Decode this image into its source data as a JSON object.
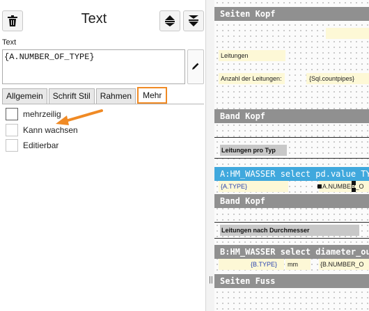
{
  "panel": {
    "title": "Text",
    "text_label": "Text",
    "text_value": "{A.NUMBER_OF_TYPE}",
    "tabs": [
      {
        "label": "Allgemein"
      },
      {
        "label": "Schrift Stil"
      },
      {
        "label": "Rahmen"
      },
      {
        "label": "Mehr",
        "active": true
      }
    ],
    "options": [
      {
        "label": "mehrzeilig",
        "checked": false
      },
      {
        "label": "Kann wachsen",
        "checked": false
      },
      {
        "label": "Editierbar",
        "checked": false
      }
    ],
    "icons": {
      "delete": "trash-icon",
      "move_up": "bring-forward-icon",
      "move_down": "send-backward-icon",
      "edit": "pencil-icon"
    },
    "accent_color": "#f08a24"
  },
  "splitter": {
    "grip": "||"
  },
  "report": {
    "bands": {
      "page_header": "Seiten Kopf",
      "group_header_1": "Band Kopf",
      "data_1": "A:HM_WASSER select pd.value TYPE,",
      "group_header_2": "Band Kopf",
      "data_2": "B:HM_WASSER select diameter_outs:",
      "page_footer": "Seiten Fuss"
    },
    "fields": {
      "leitungen": "Leitungen",
      "anzahl_label": "Anzahl der Leitungen:",
      "count_pipes": "{Sql.countpipes}",
      "leitungen_pro_typ": "Leitungen pro Typ",
      "a_type": "{A.TYPE}",
      "a_number": "A.NUMBER_O",
      "leitungen_durchmesser": "Leitungen nach Durchmesser",
      "b_type": "{B.TYPE}",
      "mm": "mm",
      "b_number": "{B.NUMBER_O"
    },
    "colors": {
      "band_header": "#909090",
      "data_band": "#40a8dd",
      "field_background": "#fdf8d6"
    }
  }
}
